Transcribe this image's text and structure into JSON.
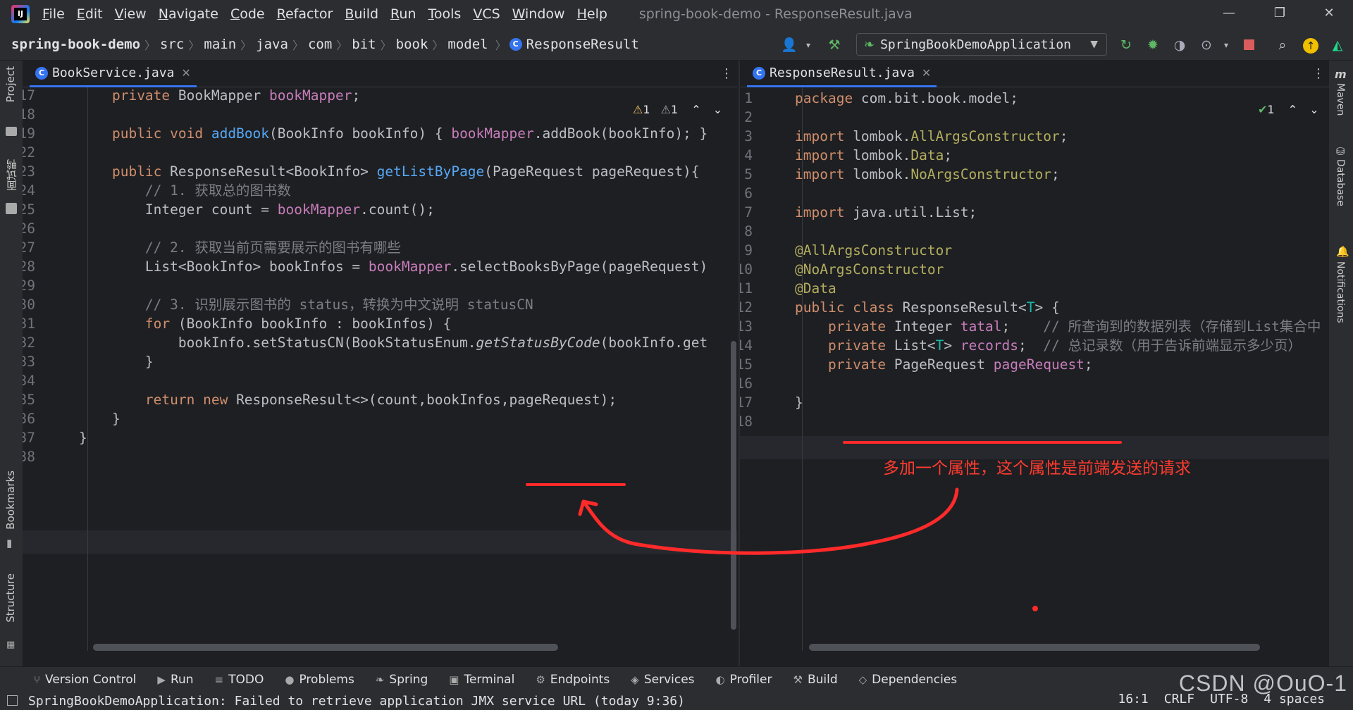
{
  "menu": {
    "items": [
      "File",
      "Edit",
      "View",
      "Navigate",
      "Code",
      "Refactor",
      "Build",
      "Run",
      "Tools",
      "VCS",
      "Window",
      "Help"
    ],
    "window_title": "spring-book-demo - ResponseResult.java"
  },
  "breadcrumb": {
    "project": "spring-book-demo",
    "parts": [
      "src",
      "main",
      "java",
      "com",
      "bit",
      "book",
      "model"
    ],
    "file": "ResponseResult"
  },
  "toolbar": {
    "run_config": "SpringBookDemoApplication"
  },
  "left_strip": {
    "project": "Project",
    "mianshi": "面试鸭",
    "bookmarks": "Bookmarks",
    "structure": "Structure"
  },
  "right_strip": {
    "maven": "Maven",
    "database": "Database",
    "notifications": "Notifications"
  },
  "left_editor": {
    "tab": "BookService.java",
    "inspection_warn": "1",
    "inspection_weak": "1",
    "lines": [
      {
        "n": "17",
        "html": "    <span class='kw'>private</span> BookMapper <span class='fld'>bookMapper</span>;"
      },
      {
        "n": "18",
        "html": ""
      },
      {
        "n": "19",
        "html": "    <span class='kw'>public void</span> <span class='gold'>addBook</span>(BookInfo bookInfo) { <span class='fld'>bookMapper</span>.addBook(bookInfo); }"
      },
      {
        "n": "22",
        "html": ""
      },
      {
        "n": "23",
        "html": "    <span class='kw'>public</span> ResponseResult&lt;BookInfo&gt; <span class='gold'>getListByPage</span>(PageRequest pageRequest){"
      },
      {
        "n": "24",
        "html": "        <span class='cm'>// 1. 获取总的图书数</span>"
      },
      {
        "n": "25",
        "html": "        Integer count = <span class='fld'>bookMapper</span>.count();"
      },
      {
        "n": "26",
        "html": ""
      },
      {
        "n": "27",
        "html": "        <span class='cm'>// 2. 获取当前页需要展示的图书有哪些</span>"
      },
      {
        "n": "28",
        "html": "        List&lt;BookInfo&gt; bookInfos = <span class='fld'>bookMapper</span>.selectBooksByPage(pageRequest)"
      },
      {
        "n": "29",
        "html": ""
      },
      {
        "n": "30",
        "html": "        <span class='cm'>// 3. 识别展示图书的 status，转换为中文说明 statusCN</span>"
      },
      {
        "n": "31",
        "html": "        <span class='kw'>for</span> (BookInfo bookInfo : bookInfos) {"
      },
      {
        "n": "32",
        "html": "            bookInfo.setStatusCN(BookStatusEnum.<span class='it'>getStatusByCode</span>(bookInfo.get"
      },
      {
        "n": "33",
        "html": "        }"
      },
      {
        "n": "34",
        "html": ""
      },
      {
        "n": "35",
        "html": "        <span class='kw'>return new</span> ResponseResult&lt;&gt;(count,bookInfos,pageRequest);"
      },
      {
        "n": "36",
        "html": "    }"
      },
      {
        "n": "37",
        "html": "}"
      },
      {
        "n": "38",
        "html": ""
      }
    ]
  },
  "right_editor": {
    "tab": "ResponseResult.java",
    "inspection_ok": "1",
    "lines": [
      {
        "n": "1",
        "html": "<span class='kw'>package</span> com.bit.book.model;"
      },
      {
        "n": "2",
        "html": ""
      },
      {
        "n": "3",
        "html": "<span class='kw'>import</span> lombok.<span class='ann'>AllArgsConstructor</span>;"
      },
      {
        "n": "4",
        "html": "<span class='kw'>import</span> lombok.<span class='ann'>Data</span>;"
      },
      {
        "n": "5",
        "html": "<span class='kw'>import</span> lombok.<span class='ann'>NoArgsConstructor</span>;"
      },
      {
        "n": "6",
        "html": ""
      },
      {
        "n": "7",
        "html": "<span class='kw'>import</span> java.util.List;"
      },
      {
        "n": "8",
        "html": ""
      },
      {
        "n": "9",
        "html": "<span class='ann'>@AllArgsConstructor</span>"
      },
      {
        "n": "10",
        "html": "<span class='ann'>@NoArgsConstructor</span>"
      },
      {
        "n": "11",
        "html": "<span class='ann'>@Data</span>"
      },
      {
        "n": "12",
        "html": "<span class='kw'>public class</span> ResponseResult&lt;<span class='tp'>T</span>&gt; {"
      },
      {
        "n": "13",
        "html": "    <span class='kw'>private</span> Integer <span class='fld'>tatal</span>;    <span class='cm'>// 所查询到的数据列表（存储到List集合中</span>"
      },
      {
        "n": "14",
        "html": "    <span class='kw'>private</span> List&lt;<span class='tp'>T</span>&gt; <span class='fld'>records</span>;  <span class='cm'>// 总记录数（用于告诉前端显示多少页）</span>"
      },
      {
        "n": "15",
        "html": "    <span class='kw'>private</span> PageRequest <span class='fld'>pageRequest</span>;"
      },
      {
        "n": "16",
        "html": ""
      },
      {
        "n": "17",
        "html": "}"
      },
      {
        "n": "18",
        "html": ""
      }
    ]
  },
  "annotation": {
    "text": "多加一个属性，这个属性是前端发送的请求"
  },
  "tool_windows": [
    {
      "icon": "⑂",
      "label": "Version Control"
    },
    {
      "icon": "▶",
      "label": "Run"
    },
    {
      "icon": "≡",
      "label": "TODO"
    },
    {
      "icon": "●",
      "label": "Problems"
    },
    {
      "icon": "❧",
      "label": "Spring"
    },
    {
      "icon": "▣",
      "label": "Terminal"
    },
    {
      "icon": "⚙",
      "label": "Endpoints"
    },
    {
      "icon": "◈",
      "label": "Services"
    },
    {
      "icon": "◐",
      "label": "Profiler"
    },
    {
      "icon": "⚒",
      "label": "Build"
    },
    {
      "icon": "◇",
      "label": "Dependencies"
    }
  ],
  "status": {
    "message": "SpringBookDemoApplication: Failed to retrieve application JMX service URL (today 9:36)",
    "position": "16:1",
    "line_sep": "CRLF",
    "encoding": "UTF-8",
    "indent": "4 spaces"
  },
  "watermark": "CSDN @OuO-1"
}
